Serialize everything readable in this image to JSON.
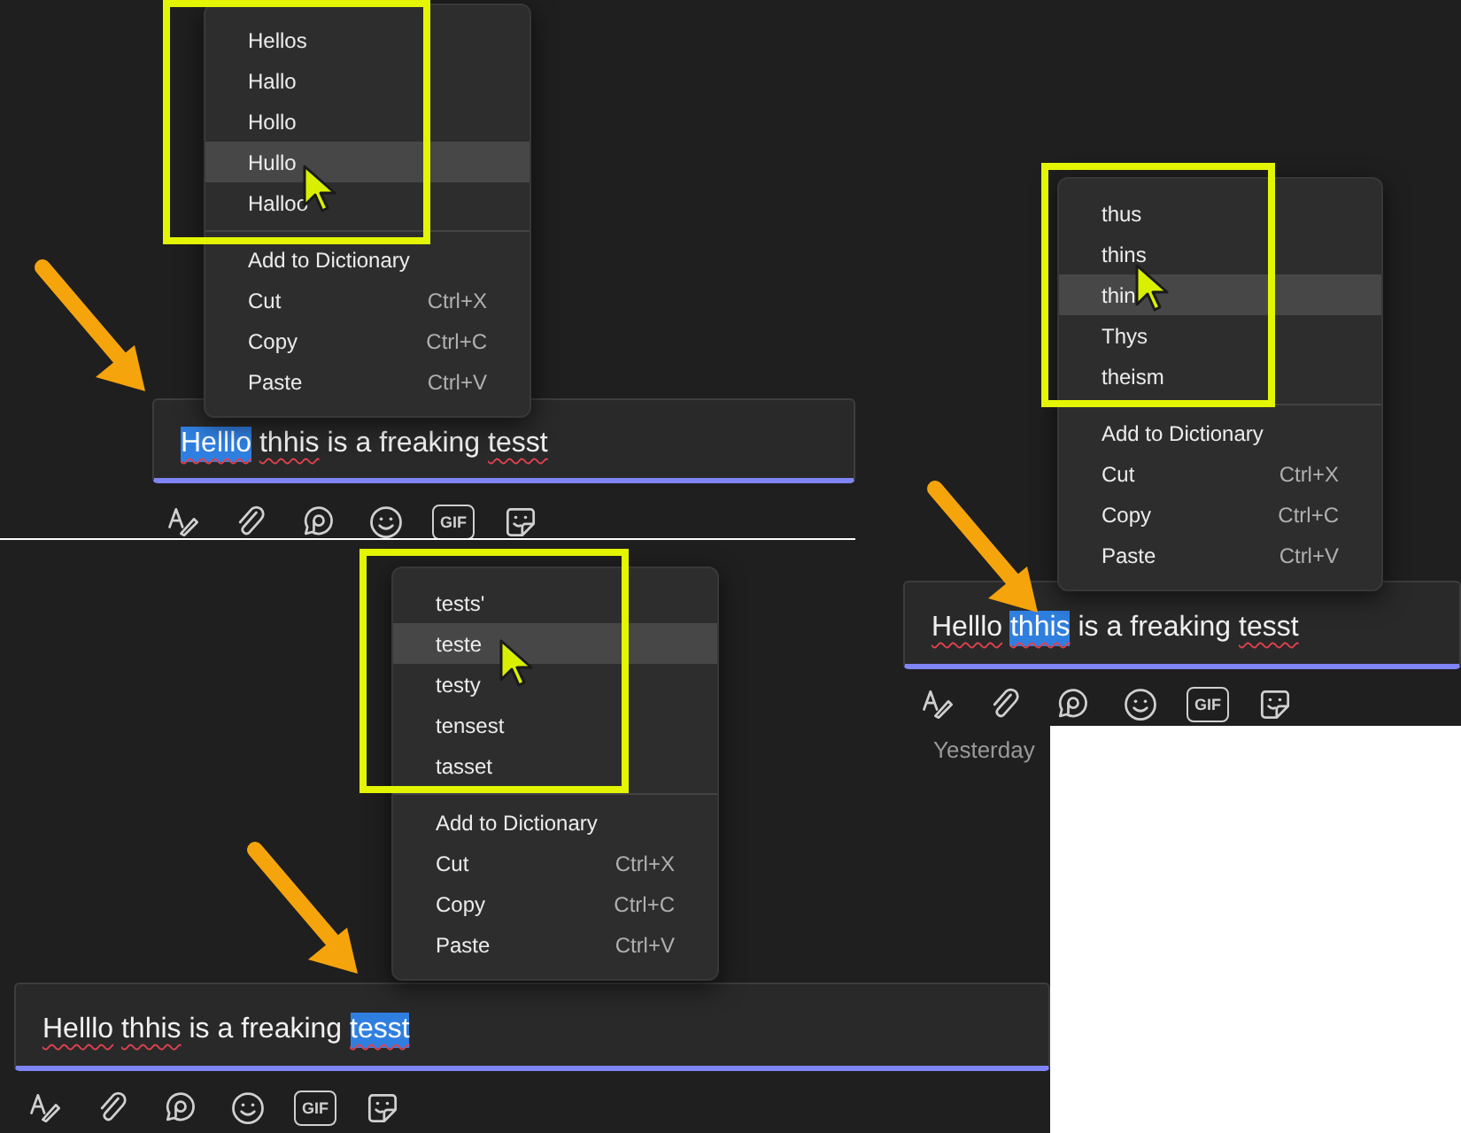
{
  "panels": [
    {
      "suggestions": [
        {
          "label": "Hellos",
          "selected": false
        },
        {
          "label": "Hallo",
          "selected": false
        },
        {
          "label": "Hollo",
          "selected": false
        },
        {
          "label": "Hullo",
          "selected": true
        },
        {
          "label": "Halloo",
          "selected": false
        }
      ],
      "actions": [
        {
          "label": "Add to Dictionary"
        },
        {
          "label": "Cut",
          "shortcut": "Ctrl+X"
        },
        {
          "label": "Copy",
          "shortcut": "Ctrl+C"
        },
        {
          "label": "Paste",
          "shortcut": "Ctrl+V"
        }
      ],
      "message": {
        "words": [
          {
            "text": "Helllo",
            "misspelled": true,
            "selected": true
          },
          {
            "text": "thhis",
            "misspelled": true,
            "selected": false
          },
          {
            "text": "is",
            "misspelled": false,
            "selected": false
          },
          {
            "text": "a",
            "misspelled": false,
            "selected": false
          },
          {
            "text": "freaking",
            "misspelled": false,
            "selected": false
          },
          {
            "text": "tesst",
            "misspelled": true,
            "selected": false
          }
        ]
      },
      "gif_label": "GIF"
    },
    {
      "suggestions": [
        {
          "label": "tests'",
          "selected": false
        },
        {
          "label": "teste",
          "selected": true
        },
        {
          "label": "testy",
          "selected": false
        },
        {
          "label": "tensest",
          "selected": false
        },
        {
          "label": "tasset",
          "selected": false
        }
      ],
      "actions": [
        {
          "label": "Add to Dictionary"
        },
        {
          "label": "Cut",
          "shortcut": "Ctrl+X"
        },
        {
          "label": "Copy",
          "shortcut": "Ctrl+C"
        },
        {
          "label": "Paste",
          "shortcut": "Ctrl+V"
        }
      ],
      "message": {
        "words": [
          {
            "text": "Helllo",
            "misspelled": true,
            "selected": false
          },
          {
            "text": "thhis",
            "misspelled": true,
            "selected": false
          },
          {
            "text": "is",
            "misspelled": false,
            "selected": false
          },
          {
            "text": "a",
            "misspelled": false,
            "selected": false
          },
          {
            "text": "freaking",
            "misspelled": false,
            "selected": false
          },
          {
            "text": "tesst",
            "misspelled": true,
            "selected": true
          }
        ]
      },
      "gif_label": "GIF"
    },
    {
      "suggestions": [
        {
          "label": "thus",
          "selected": false
        },
        {
          "label": "thins",
          "selected": false
        },
        {
          "label": "thin",
          "selected": true
        },
        {
          "label": "Thys",
          "selected": false
        },
        {
          "label": "theism",
          "selected": false
        }
      ],
      "actions": [
        {
          "label": "Add to Dictionary"
        },
        {
          "label": "Cut",
          "shortcut": "Ctrl+X"
        },
        {
          "label": "Copy",
          "shortcut": "Ctrl+C"
        },
        {
          "label": "Paste",
          "shortcut": "Ctrl+V"
        }
      ],
      "message": {
        "words": [
          {
            "text": "Helllo",
            "misspelled": true,
            "selected": false
          },
          {
            "text": "thhis",
            "misspelled": true,
            "selected": true
          },
          {
            "text": "is",
            "misspelled": false,
            "selected": false
          },
          {
            "text": "a",
            "misspelled": false,
            "selected": false
          },
          {
            "text": "freaking",
            "misspelled": false,
            "selected": false
          },
          {
            "text": "tesst",
            "misspelled": true,
            "selected": false
          }
        ]
      },
      "gif_label": "GIF",
      "timestamp": "Yesterday"
    }
  ]
}
